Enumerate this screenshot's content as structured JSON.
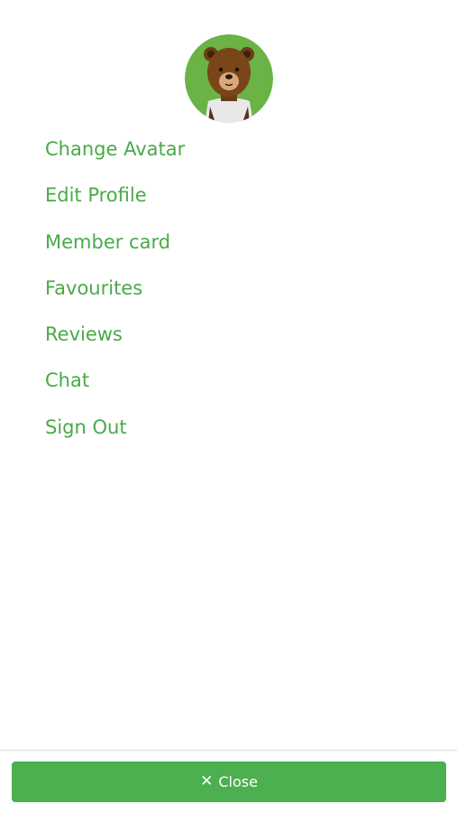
{
  "profile": {
    "avatar_icon": "bear-avatar-icon",
    "avatar_bg_color": "#6ab344"
  },
  "menu": {
    "items": [
      {
        "label": "Change Avatar"
      },
      {
        "label": "Edit Profile"
      },
      {
        "label": "Member card"
      },
      {
        "label": "Favourites"
      },
      {
        "label": "Reviews"
      },
      {
        "label": "Chat"
      },
      {
        "label": "Sign Out"
      }
    ],
    "text_color": "#4aaa47"
  },
  "footer": {
    "close_icon": "close-icon",
    "close_label": "Close",
    "button_color": "#4caf50"
  }
}
